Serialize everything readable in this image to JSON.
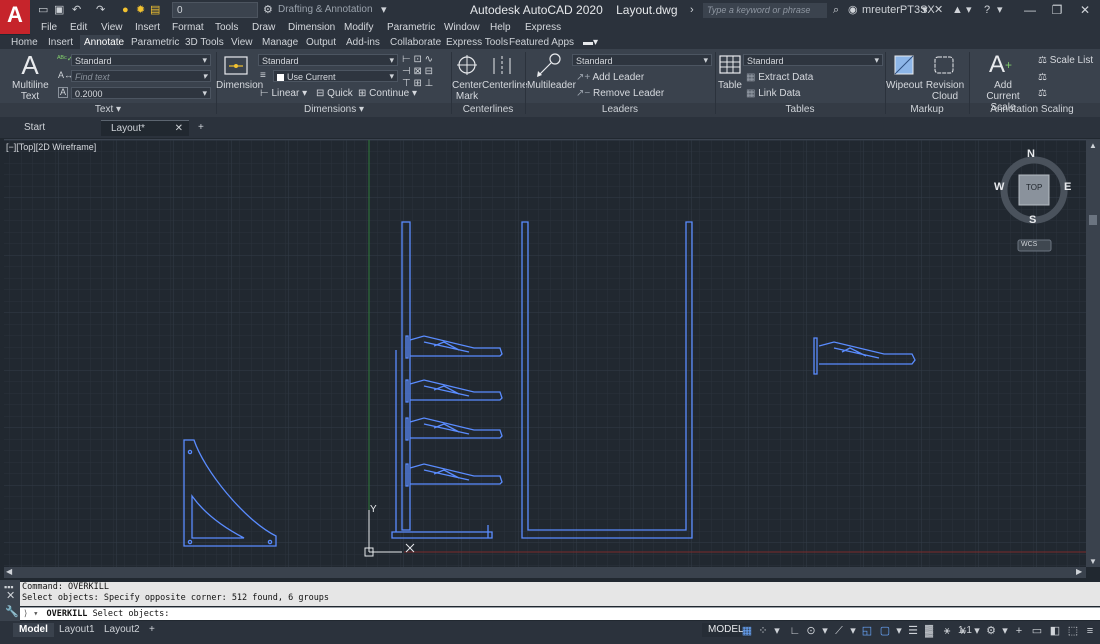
{
  "title_bar": {
    "app_logo": "A",
    "layer_value": "0",
    "workspace": "Drafting & Annotation",
    "app_title": "Autodesk AutoCAD 2020",
    "document": "Layout.dwg",
    "search_placeholder": "Type a keyword or phrase",
    "user": "mreuterPT3SX"
  },
  "menu": [
    "File",
    "Edit",
    "View",
    "Insert",
    "Format",
    "Tools",
    "Draw",
    "Dimension",
    "Modify",
    "Parametric",
    "Window",
    "Help",
    "Express"
  ],
  "ribbon_tabs": [
    "Home",
    "Insert",
    "Annotate",
    "Parametric",
    "3D Tools",
    "View",
    "Manage",
    "Output",
    "Add-ins",
    "Collaborate",
    "Express Tools",
    "Featured Apps"
  ],
  "active_ribbon_tab": "Annotate",
  "ribbon": {
    "text": {
      "big_label_1": "Multiline",
      "big_label_2": "Text",
      "style": "Standard",
      "find_placeholder": "Find text",
      "height": "0.2000",
      "panel_title": "Text ▾"
    },
    "dimensions": {
      "big_label": "Dimension",
      "style": "Standard",
      "layer": "Use Current",
      "linear": "Linear",
      "quick": "Quick",
      "continue": "Continue",
      "panel_title": "Dimensions ▾"
    },
    "centerlines": {
      "center_mark_1": "Center",
      "center_mark_2": "Mark",
      "centerline": "Centerline",
      "panel_title": "Centerlines"
    },
    "leaders": {
      "big_label": "Multileader",
      "style": "Standard",
      "add": "Add Leader",
      "remove": "Remove Leader",
      "panel_title": "Leaders"
    },
    "tables": {
      "big_label": "Table",
      "style": "Standard",
      "extract": "Extract Data",
      "link": "Link Data",
      "panel_title": "Tables"
    },
    "markup": {
      "wipeout": "Wipeout",
      "revision_1": "Revision",
      "revision_2": "Cloud",
      "panel_title": "Markup"
    },
    "scaling": {
      "add_1": "Add",
      "add_2": "Current Scale",
      "scale_list": "Scale List",
      "panel_title": "Annotation Scaling"
    }
  },
  "doc_tabs": [
    "Start",
    "Layout*"
  ],
  "viewport": {
    "label": "[−][Top][2D Wireframe]",
    "viewcube": {
      "top": "TOP",
      "n": "N",
      "s": "S",
      "e": "E",
      "w": "W",
      "wcs": "WCS"
    },
    "ucs_y": "Y"
  },
  "command": {
    "line1": "Command: OVERKILL",
    "line2": "Select objects: Specify opposite corner: 512 found, 6 groups",
    "prompt_cmd": "OVERKILL",
    "prompt_text": "Select objects:"
  },
  "status": {
    "tabs": [
      "Model",
      "Layout1",
      "Layout2"
    ],
    "active_tab": "Model",
    "space": "MODEL",
    "scale": "1:1"
  },
  "colors": {
    "geometry": "#5a8cff",
    "background": "#212830",
    "accent_red": "#c6242b"
  }
}
